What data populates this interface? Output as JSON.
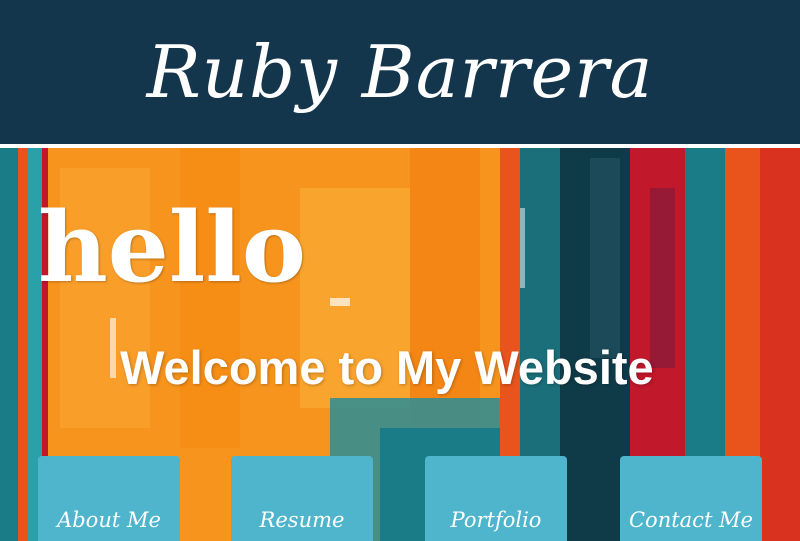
{
  "header": {
    "title": "Ruby Barrera",
    "background": "#14364c"
  },
  "hero": {
    "greeting": "hello",
    "welcome": "Welcome to My Website",
    "palette": [
      "#f7941d",
      "#e8541c",
      "#1a7c86",
      "#0f3b48",
      "#c2182b"
    ]
  },
  "nav": {
    "tile_color": "#4fb5cc",
    "items": [
      {
        "label": "About Me"
      },
      {
        "label": "Resume"
      },
      {
        "label": "Portfolio"
      },
      {
        "label": "Contact Me"
      }
    ]
  }
}
